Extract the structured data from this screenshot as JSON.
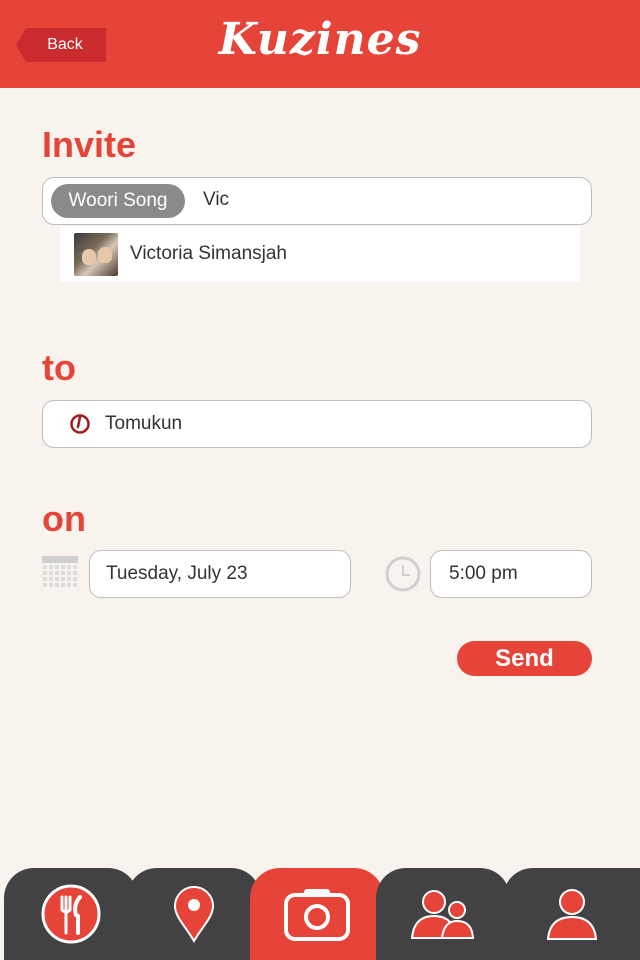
{
  "header": {
    "back_label": "Back",
    "logo_text": "Kuzines"
  },
  "invite": {
    "title": "Invite",
    "chip": "Woori Song",
    "typed_text": "Vic",
    "suggestion": {
      "name": "Victoria Simansjah"
    }
  },
  "to": {
    "title": "to",
    "place": "Tomukun"
  },
  "on": {
    "title": "on",
    "date": "Tuesday, July 23",
    "time": "5:00 pm"
  },
  "send_label": "Send",
  "tabs": [
    {
      "icon": "dining-icon"
    },
    {
      "icon": "location-pin-icon"
    },
    {
      "icon": "camera-icon",
      "active": true
    },
    {
      "icon": "friends-icon"
    },
    {
      "icon": "profile-icon"
    }
  ],
  "colors": {
    "accent": "#e64339",
    "header_back": "#c92b2f",
    "tab_dark": "#424245",
    "background": "#f8f3ec"
  }
}
